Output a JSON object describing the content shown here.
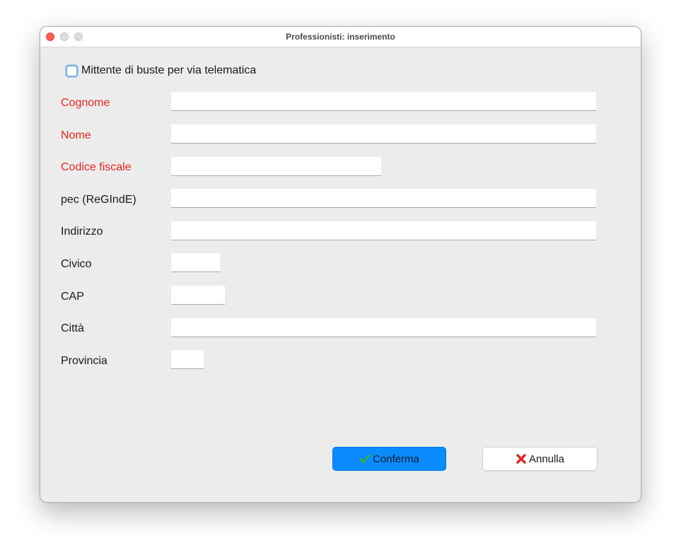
{
  "window": {
    "title": "Professionisti: inserimento"
  },
  "telematic_checkbox": {
    "label": "Mittente di buste per via telematica",
    "checked": false
  },
  "fields": {
    "cognome": {
      "label": "Cognome",
      "required": true,
      "value": ""
    },
    "nome": {
      "label": "Nome",
      "required": true,
      "value": ""
    },
    "codice_fiscale": {
      "label": "Codice fiscale",
      "required": true,
      "value": ""
    },
    "pec": {
      "label": "pec (ReGIndE)",
      "required": false,
      "value": ""
    },
    "indirizzo": {
      "label": "Indirizzo",
      "required": false,
      "value": ""
    },
    "civico": {
      "label": "Civico",
      "required": false,
      "value": ""
    },
    "cap": {
      "label": "CAP",
      "required": false,
      "value": ""
    },
    "citta": {
      "label": "Città",
      "required": false,
      "value": ""
    },
    "provincia": {
      "label": "Provincia",
      "required": false,
      "value": ""
    }
  },
  "buttons": {
    "confirm": {
      "label": "Conferma",
      "icon": "checkmark-icon"
    },
    "cancel": {
      "label": "Annulla",
      "icon": "x-icon"
    }
  },
  "colors": {
    "required_label": "#e8281e",
    "confirm_button": "#0a8bfe",
    "checkmark": "#3fb62c",
    "cancel_x": "#e3241b"
  }
}
